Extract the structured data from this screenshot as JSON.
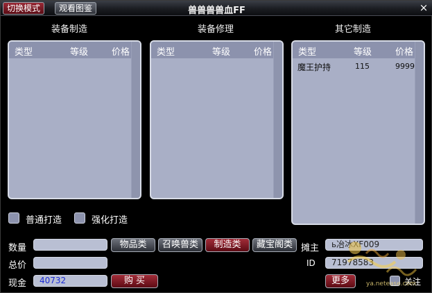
{
  "titlebar": {
    "title": "兽兽兽兽血FF",
    "switch_mode": "切换模式",
    "view_catalog": "观看图鉴",
    "close": "×"
  },
  "sections": [
    {
      "title": "装备制造",
      "headers": [
        "类型",
        "等级",
        "价格"
      ],
      "rows": []
    },
    {
      "title": "装备修理",
      "headers": [
        "类型",
        "等级",
        "价格"
      ],
      "rows": []
    },
    {
      "title": "其它制造",
      "headers": [
        "类型",
        "等级",
        "价格"
      ],
      "rows": [
        {
          "type": "魔王护持",
          "level": "115",
          "price": "9999"
        }
      ]
    }
  ],
  "options": {
    "normal": "普通打造",
    "enhanced": "强化打造"
  },
  "form": {
    "quantity_label": "数量",
    "total_label": "总价",
    "cash_label": "现金",
    "cash_value": "40732",
    "buy": "购 买"
  },
  "categories": [
    "物品类",
    "召唤兽类",
    "制造类",
    "藏宝阁类"
  ],
  "seller": {
    "owner_label": "摊主",
    "owner_value": "ь冶冰XF009",
    "id_label": "ID",
    "id_value": "71978583",
    "more": "更多",
    "follow": "关注"
  },
  "watermark": {
    "text": "ya.netease.com"
  },
  "colors": {
    "panel": "#a9afc6",
    "header": "#8c92ad",
    "accent_red": "#8a1f2a",
    "cash_text": "#1a2bd6"
  }
}
